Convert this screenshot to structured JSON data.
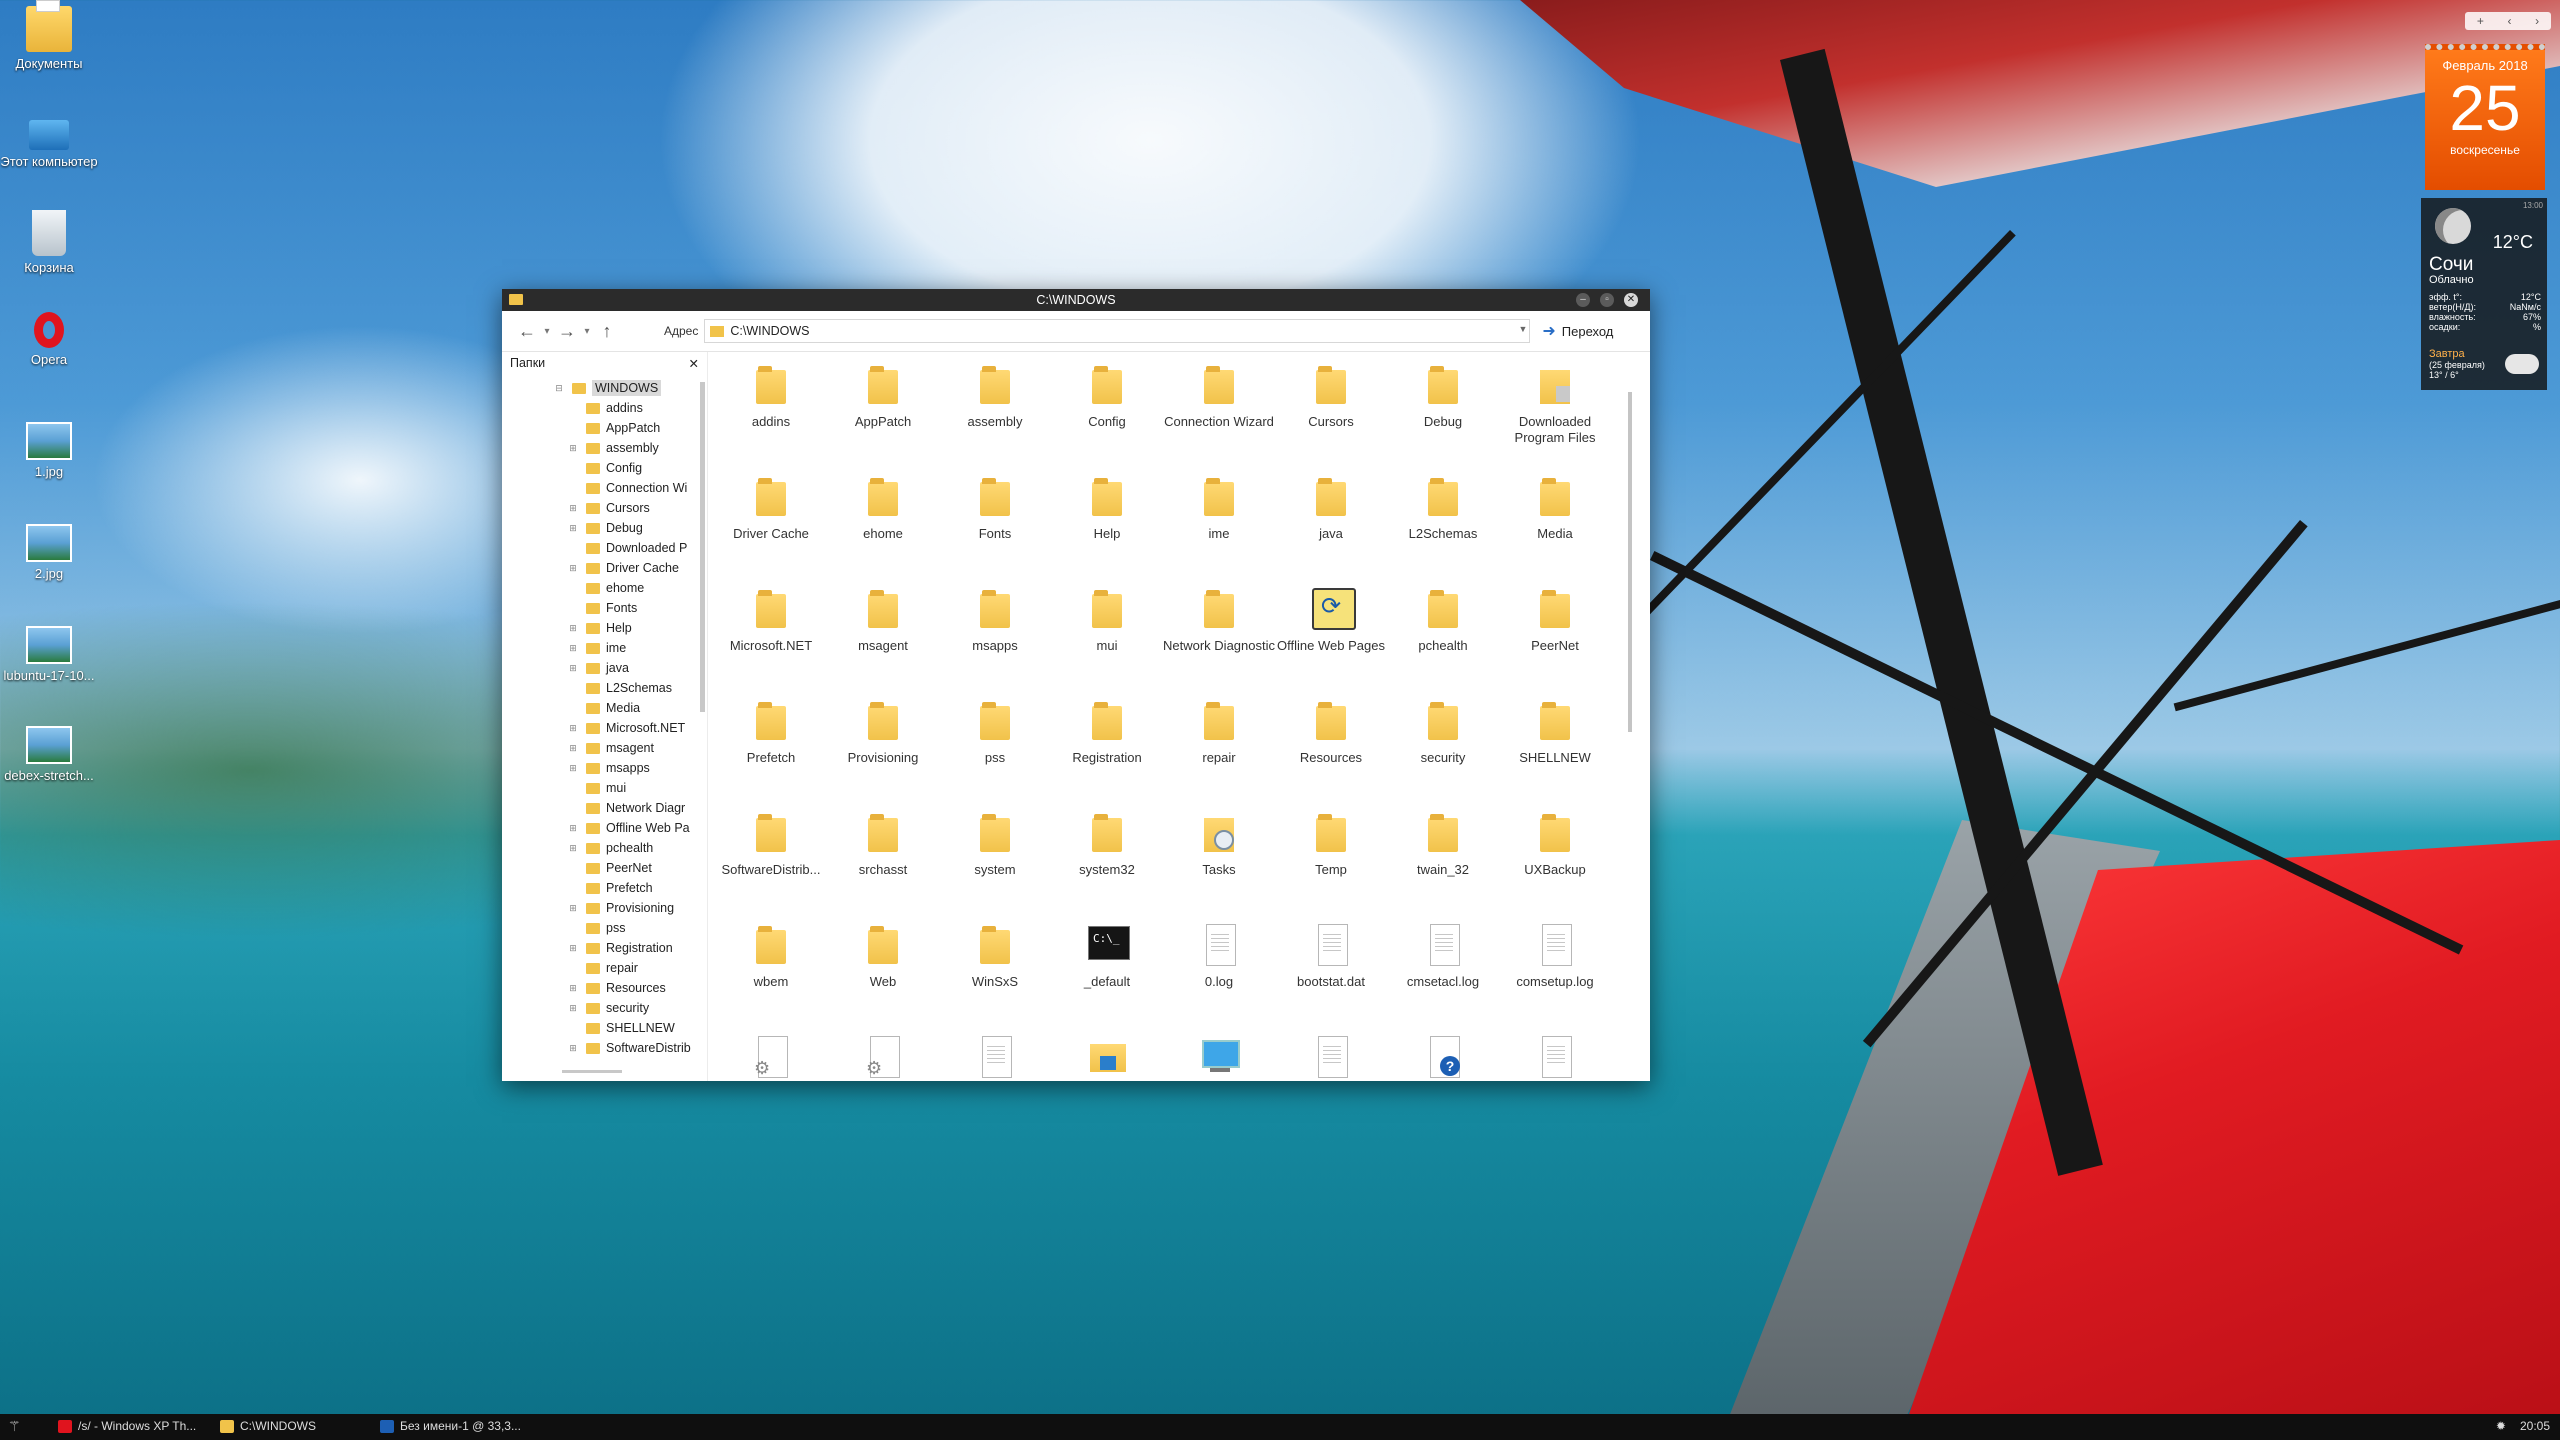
{
  "desktop": {
    "icons": [
      {
        "label": "Документы",
        "icon": "documents-folder-icon"
      },
      {
        "label": "Этот компьютер",
        "icon": "computer-icon"
      },
      {
        "label": "Корзина",
        "icon": "recycle-bin-icon"
      },
      {
        "label": "Opera",
        "icon": "opera-icon"
      },
      {
        "label": "1.jpg",
        "icon": "image-file-icon"
      },
      {
        "label": "2.jpg",
        "icon": "image-file-icon"
      },
      {
        "label": "lubuntu-17-10...",
        "icon": "image-file-icon"
      },
      {
        "label": "debex-stretch...",
        "icon": "image-file-icon"
      }
    ]
  },
  "window": {
    "title": "C:\\WINDOWS",
    "toolbar": {
      "address_label": "Адрес",
      "address_value": "C:\\WINDOWS",
      "go_label": "Переход"
    },
    "tree": {
      "header": "Папки",
      "items": [
        {
          "label": "WINDOWS",
          "expander": "⊟",
          "root": true
        },
        {
          "label": "addins",
          "expander": ""
        },
        {
          "label": "AppPatch",
          "expander": ""
        },
        {
          "label": "assembly",
          "expander": "⊞"
        },
        {
          "label": "Config",
          "expander": ""
        },
        {
          "label": "Connection Wi",
          "expander": ""
        },
        {
          "label": "Cursors",
          "expander": "⊞"
        },
        {
          "label": "Debug",
          "expander": "⊞"
        },
        {
          "label": "Downloaded P",
          "expander": ""
        },
        {
          "label": "Driver Cache",
          "expander": "⊞"
        },
        {
          "label": "ehome",
          "expander": ""
        },
        {
          "label": "Fonts",
          "expander": ""
        },
        {
          "label": "Help",
          "expander": "⊞"
        },
        {
          "label": "ime",
          "expander": "⊞"
        },
        {
          "label": "java",
          "expander": "⊞"
        },
        {
          "label": "L2Schemas",
          "expander": ""
        },
        {
          "label": "Media",
          "expander": ""
        },
        {
          "label": "Microsoft.NET",
          "expander": "⊞"
        },
        {
          "label": "msagent",
          "expander": "⊞"
        },
        {
          "label": "msapps",
          "expander": "⊞"
        },
        {
          "label": "mui",
          "expander": ""
        },
        {
          "label": "Network Diagr",
          "expander": ""
        },
        {
          "label": "Offline Web Pa",
          "expander": "⊞"
        },
        {
          "label": "pchealth",
          "expander": "⊞"
        },
        {
          "label": "PeerNet",
          "expander": ""
        },
        {
          "label": "Prefetch",
          "expander": ""
        },
        {
          "label": "Provisioning",
          "expander": "⊞"
        },
        {
          "label": "pss",
          "expander": ""
        },
        {
          "label": "Registration",
          "expander": "⊞"
        },
        {
          "label": "repair",
          "expander": ""
        },
        {
          "label": "Resources",
          "expander": "⊞"
        },
        {
          "label": "security",
          "expander": "⊞"
        },
        {
          "label": "SHELLNEW",
          "expander": ""
        },
        {
          "label": "SoftwareDistrib",
          "expander": "⊞"
        }
      ]
    },
    "items": [
      {
        "label": "addins",
        "type": "folder"
      },
      {
        "label": "AppPatch",
        "type": "folder"
      },
      {
        "label": "assembly",
        "type": "folder"
      },
      {
        "label": "Config",
        "type": "folder"
      },
      {
        "label": "Connection Wizard",
        "type": "folder"
      },
      {
        "label": "Cursors",
        "type": "folder"
      },
      {
        "label": "Debug",
        "type": "folder"
      },
      {
        "label": "Downloaded Program Files",
        "type": "dl"
      },
      {
        "label": "Driver Cache",
        "type": "folder"
      },
      {
        "label": "ehome",
        "type": "folder"
      },
      {
        "label": "Fonts",
        "type": "folder"
      },
      {
        "label": "Help",
        "type": "folder"
      },
      {
        "label": "ime",
        "type": "folder"
      },
      {
        "label": "java",
        "type": "folder"
      },
      {
        "label": "L2Schemas",
        "type": "folder"
      },
      {
        "label": "Media",
        "type": "folder"
      },
      {
        "label": "Microsoft.NET",
        "type": "folder"
      },
      {
        "label": "msagent",
        "type": "folder"
      },
      {
        "label": "msapps",
        "type": "folder"
      },
      {
        "label": "mui",
        "type": "folder"
      },
      {
        "label": "Network Diagnostic",
        "type": "folder"
      },
      {
        "label": "Offline Web Pages",
        "type": "web"
      },
      {
        "label": "pchealth",
        "type": "folder"
      },
      {
        "label": "PeerNet",
        "type": "folder"
      },
      {
        "label": "Prefetch",
        "type": "folder"
      },
      {
        "label": "Provisioning",
        "type": "folder"
      },
      {
        "label": "pss",
        "type": "folder"
      },
      {
        "label": "Registration",
        "type": "folder"
      },
      {
        "label": "repair",
        "type": "folder"
      },
      {
        "label": "Resources",
        "type": "folder"
      },
      {
        "label": "security",
        "type": "folder"
      },
      {
        "label": "SHELLNEW",
        "type": "folder"
      },
      {
        "label": "SoftwareDistrib...",
        "type": "folder"
      },
      {
        "label": "srchasst",
        "type": "folder"
      },
      {
        "label": "system",
        "type": "folder"
      },
      {
        "label": "system32",
        "type": "folder"
      },
      {
        "label": "Tasks",
        "type": "tasks"
      },
      {
        "label": "Temp",
        "type": "folder"
      },
      {
        "label": "twain_32",
        "type": "folder"
      },
      {
        "label": "UXBackup",
        "type": "folder"
      },
      {
        "label": "wbem",
        "type": "folder"
      },
      {
        "label": "Web",
        "type": "folder"
      },
      {
        "label": "WinSxS",
        "type": "folder"
      },
      {
        "label": "_default",
        "type": "cmd"
      },
      {
        "label": "0.log",
        "type": "file"
      },
      {
        "label": "bootstat.dat",
        "type": "file"
      },
      {
        "label": "cmsetacl.log",
        "type": "file"
      },
      {
        "label": "comsetup.log",
        "type": "file"
      },
      {
        "label": "",
        "type": "cog"
      },
      {
        "label": "",
        "type": "cog"
      },
      {
        "label": "",
        "type": "file"
      },
      {
        "label": "",
        "type": "exp"
      },
      {
        "label": "",
        "type": "mon"
      },
      {
        "label": "",
        "type": "file"
      },
      {
        "label": "",
        "type": "help"
      },
      {
        "label": "",
        "type": "file"
      }
    ]
  },
  "calendar": {
    "month": "Февраль 2018",
    "day": "25",
    "weekday": "воскресенье"
  },
  "weather": {
    "time": "13:00",
    "temp": "12°C",
    "city": "Сочи",
    "condition": "Облачно",
    "rows": [
      {
        "k": "эфф. t°:",
        "v": "12°C"
      },
      {
        "k": "ветер(Н/Д):",
        "v": "NaNм/с"
      },
      {
        "k": "влажность:",
        "v": "67%"
      },
      {
        "k": "осадки:",
        "v": "%"
      }
    ],
    "tomorrow_label": "Завтра",
    "tomorrow_date": "(25 февраля)",
    "tomorrow_temp": "13° / 6°"
  },
  "taskbar": {
    "tasks": [
      {
        "label": "/s/ - Windows XP Th...",
        "color": "#e0141e"
      },
      {
        "label": "C:\\WINDOWS",
        "color": "#f1c34a"
      },
      {
        "label": "Без имени-1 @ 33,3...",
        "color": "#1d5fb4"
      }
    ],
    "clock": "20:05"
  }
}
